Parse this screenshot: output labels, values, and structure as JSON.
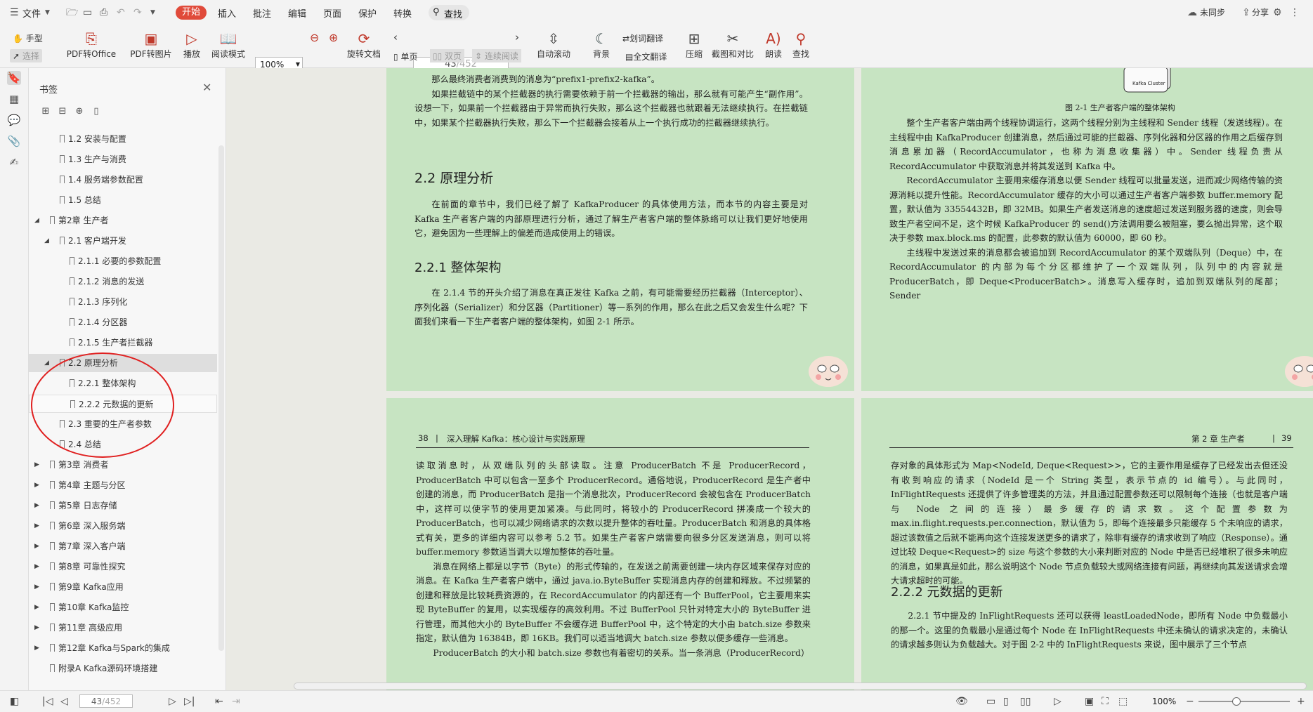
{
  "menubar": {
    "file_label": "文件",
    "tabs": [
      "开始",
      "插入",
      "批注",
      "编辑",
      "页面",
      "保护",
      "转换"
    ],
    "search_label": "查找",
    "sync_label": "未同步",
    "share_label": "分享"
  },
  "toolbar": {
    "hand_label": "手型",
    "select_label": "选择",
    "pdf_to_office": "PDF转Office",
    "pdf_to_image": "PDF转图片",
    "play": "播放",
    "read_mode": "阅读模式",
    "zoom_value": "100%",
    "rotate": "旋转文档",
    "page_current": "43",
    "page_total": "/452",
    "single_page": "单页",
    "double_page": "双页",
    "continuous": "连续阅读",
    "auto_scroll": "自动滚动",
    "background": "背景",
    "word_translate": "划词翻译",
    "full_translate": "全文翻译",
    "compress": "压缩",
    "screenshot_compare": "截图和对比",
    "read_aloud": "朗读",
    "find": "查找"
  },
  "bookmarks": {
    "title": "书签",
    "items": [
      {
        "label": "1.2 安装与配置",
        "level": 1,
        "arrow": ""
      },
      {
        "label": "1.3 生产与消费",
        "level": 1,
        "arrow": ""
      },
      {
        "label": "1.4 服务端参数配置",
        "level": 1,
        "arrow": ""
      },
      {
        "label": "1.5 总结",
        "level": 1,
        "arrow": ""
      },
      {
        "label": "第2章 生产者",
        "level": 0,
        "arrow": "◢"
      },
      {
        "label": "2.1 客户端开发",
        "level": 1,
        "arrow": "◢"
      },
      {
        "label": "2.1.1 必要的参数配置",
        "level": 2,
        "arrow": ""
      },
      {
        "label": "2.1.2 消息的发送",
        "level": 2,
        "arrow": ""
      },
      {
        "label": "2.1.3 序列化",
        "level": 2,
        "arrow": ""
      },
      {
        "label": "2.1.4 分区器",
        "level": 2,
        "arrow": ""
      },
      {
        "label": "2.1.5 生产者拦截器",
        "level": 2,
        "arrow": ""
      },
      {
        "label": "2.2 原理分析",
        "level": 1,
        "arrow": "◢"
      },
      {
        "label": "2.2.1 整体架构",
        "level": 2,
        "arrow": ""
      },
      {
        "label": "2.2.2 元数据的更新",
        "level": 2,
        "arrow": ""
      },
      {
        "label": "2.3 重要的生产者参数",
        "level": 1,
        "arrow": ""
      },
      {
        "label": "2.4 总结",
        "level": 1,
        "arrow": ""
      },
      {
        "label": "第3章 消费者",
        "level": 0,
        "arrow": "▶"
      },
      {
        "label": "第4章 主题与分区",
        "level": 0,
        "arrow": "▶"
      },
      {
        "label": "第5章 日志存储",
        "level": 0,
        "arrow": "▶"
      },
      {
        "label": "第6章 深入服务端",
        "level": 0,
        "arrow": "▶"
      },
      {
        "label": "第7章 深入客户端",
        "level": 0,
        "arrow": "▶"
      },
      {
        "label": "第8章 可靠性探究",
        "level": 0,
        "arrow": "▶"
      },
      {
        "label": "第9章 Kafka应用",
        "level": 0,
        "arrow": "▶"
      },
      {
        "label": "第10章 Kafka监控",
        "level": 0,
        "arrow": "▶"
      },
      {
        "label": "第11章 高级应用",
        "level": 0,
        "arrow": "▶"
      },
      {
        "label": "第12章 Kafka与Spark的集成",
        "level": 0,
        "arrow": "▶"
      },
      {
        "label": "附录A Kafka源码环境搭建",
        "level": 0,
        "arrow": ""
      }
    ]
  },
  "doc": {
    "p1_lines": [
      "那么最终消费者消费到的消息为“prefix1-prefix2-kafka”。",
      "如果拦截链中的某个拦截器的执行需要依赖于前一个拦截器的输出，那么就有可能产生“副作用”。设想一下，如果前一个拦截器由于异常而执行失败，那么这个拦截器也就跟着无法继续执行。在拦截链中，如果某个拦截器执行失败，那么下一个拦截器会接着从上一个执行成功的拦截器继续执行。"
    ],
    "h_22": "2.2   原理分析",
    "p_22": "在前面的章节中，我们已经了解了 KafkaProducer 的具体使用方法，而本节的内容主要是对 Kafka 生产者客户端的内部原理进行分析，通过了解生产者客户端的整体脉络可以让我们更好地使用它，避免因为一些理解上的偏差而造成使用上的错误。",
    "h_221": "2.2.1   整体架构",
    "p_221": "在 2.1.4 节的开头介绍了消息在真正发往 Kafka 之前，有可能需要经历拦截器（Interceptor）、序列化器（Serializer）和分区器（Partitioner）等一系列的作用，那么在此之后又会发生什么呢？下面我们来看一下生产者客户端的整体架构，如图 2-1 所示。",
    "fig_caption": "图 2-1   生产者客户端的整体架构",
    "fig_label": "Kafka Cluster",
    "p2_a": "整个生产者客户端由两个线程协调运行，这两个线程分别为主线程和 Sender 线程（发送线程）。在主线程中由 KafkaProducer 创建消息，然后通过可能的拦截器、序列化器和分区器的作用之后缓存到消息累加器（RecordAccumulator，也称为消息收集器）中。Sender 线程负责从 RecordAccumulator 中获取消息并将其发送到 Kafka 中。",
    "p2_b": "RecordAccumulator 主要用来缓存消息以便 Sender 线程可以批量发送，进而减少网络传输的资源消耗以提升性能。RecordAccumulator 缓存的大小可以通过生产者客户端参数 buffer.memory 配置，默认值为 33554432B，即 32MB。如果生产者发送消息的速度超过发送到服务器的速度，则会导致生产者空间不足，这个时候 KafkaProducer 的 send()方法调用要么被阻塞，要么抛出异常，这个取决于参数 max.block.ms 的配置，此参数的默认值为 60000，即 60 秒。",
    "p2_c": "主线程中发送过来的消息都会被追加到 RecordAccumulator 的某个双端队列（Deque）中，在 RecordAccumulator 的内部为每个分区都维护了一个双端队列，队列中的内容就是 ProducerBatch，即 Deque<ProducerBatch>。消息写入缓存时，追加到双端队列的尾部；Sender",
    "head_left_num": "38",
    "head_left_title": "深入理解 Kafka：核心设计与实践原理",
    "p3_a": "读取消息时，从双端队列的头部读取。注意 ProducerBatch 不是 ProducerRecord，ProducerBatch 中可以包含一至多个 ProducerRecord。通俗地说，ProducerRecord 是生产者中创建的消息，而 ProducerBatch 是指一个消息批次，ProducerRecord 会被包含在 ProducerBatch 中，这样可以使字节的使用更加紧凑。与此同时，将较小的 ProducerRecord 拼凑成一个较大的 ProducerBatch，也可以减少网络请求的次数以提升整体的吞吐量。ProducerBatch 和消息的具体格式有关，更多的详细内容可以参考 5.2 节。如果生产者客户端需要向很多分区发送消息，则可以将 buffer.memory 参数适当调大以增加整体的吞吐量。",
    "p3_b": "消息在网络上都是以字节（Byte）的形式传输的，在发送之前需要创建一块内存区域来保存对应的消息。在 Kafka 生产者客户端中，通过 java.io.ByteBuffer 实现消息内存的创建和释放。不过频繁的创建和释放是比较耗费资源的，在 RecordAccumulator 的内部还有一个 BufferPool，它主要用来实现 ByteBuffer 的复用，以实现缓存的高效利用。不过 BufferPool 只针对特定大小的 ByteBuffer 进行管理，而其他大小的 ByteBuffer 不会缓存进 BufferPool 中，这个特定的大小由 batch.size 参数来指定，默认值为 16384B，即 16KB。我们可以适当地调大 batch.size 参数以便多缓存一些消息。",
    "p3_c": "ProducerBatch 的大小和 batch.size 参数也有着密切的关系。当一条消息（ProducerRecord）",
    "head_right_title": "第 2 章   生产者",
    "head_right_num": "39",
    "p4_a": "存对象的具体形式为 Map<NodeId, Deque<Request>>，它的主要作用是缓存了已经发出去但还没有收到响应的请求（NodeId 是一个 String 类型，表示节点的 id 编号）。与此同时，InFlightRequests 还提供了许多管理类的方法，并且通过配置参数还可以限制每个连接（也就是客户端与 Node 之间的连接）最多缓存的请求数。这个配置参数为 max.in.flight.requests.per.connection，默认值为 5，即每个连接最多只能缓存 5 个未响应的请求，超过该数值之后就不能再向这个连接发送更多的请求了，除非有缓存的请求收到了响应（Response）。通过比较 Deque<Request>的 size 与这个参数的大小来判断对应的 Node 中是否已经堆积了很多未响应的消息，如果真是如此，那么说明这个 Node 节点负载较大或网络连接有问题，再继续向其发送请求会增大请求超时的可能。",
    "h_222": "2.2.2   元数据的更新",
    "p4_b": "2.2.1 节中提及的 InFlightRequests 还可以获得 leastLoadedNode，即所有 Node 中负载最小的那一个。这里的负载最小是通过每个 Node 在 InFlightRequests 中还未确认的请求决定的，未确认的请求越多则认为负载越大。对于图 2-2 中的 InFlightRequests 来说，图中展示了三个节点"
  },
  "statusbar": {
    "page_current": "43",
    "page_total": "/452",
    "zoom": "100%"
  }
}
